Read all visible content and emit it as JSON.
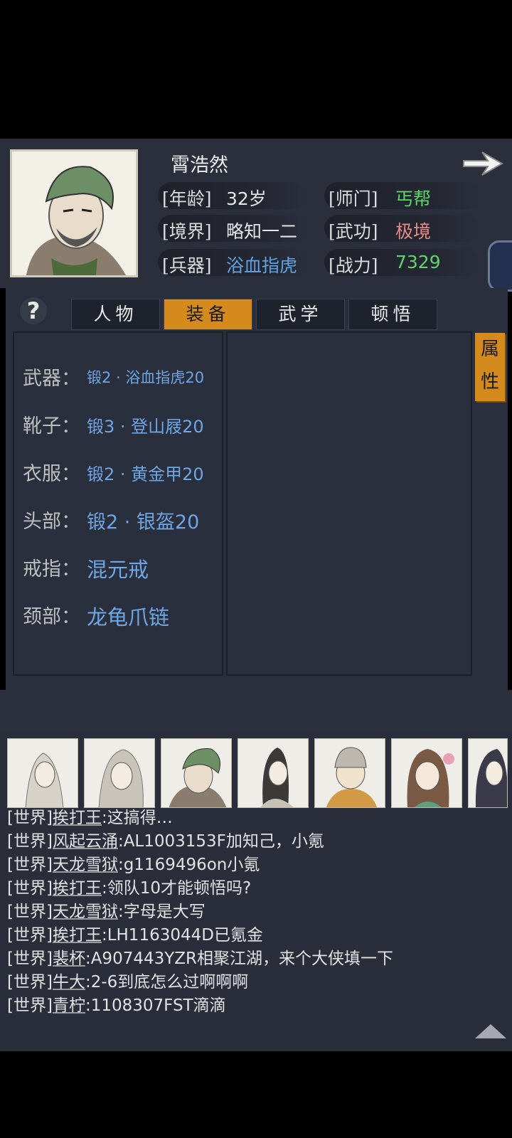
{
  "character": {
    "name": "霄浩然",
    "age_label": "[年龄]",
    "age_value": "32岁",
    "sect_label": "[师门]",
    "sect_value": "丐帮",
    "realm_label": "[境界]",
    "realm_value": "略知一二",
    "martial_label": "[武功]",
    "martial_value": "极境",
    "weapon_label": "[兵器]",
    "weapon_value": "浴血指虎",
    "power_label": "[战力]",
    "power_value": "7329"
  },
  "colors": {
    "sect": "#5fd36a",
    "martial": "#e88a86",
    "weapon": "#5fa2e6",
    "power": "#5fd36a",
    "accent_tab": "#d48a1c"
  },
  "tabs": [
    "人物",
    "装备",
    "武学",
    "顿悟"
  ],
  "active_tab": "装备",
  "side_tab": "属性",
  "equipment": [
    {
      "slot": "武器：",
      "item": "锻2 · 浴血指虎20"
    },
    {
      "slot": "靴子：",
      "item": "锻3 · 登山屐20"
    },
    {
      "slot": "衣服：",
      "item": "锻2 · 黄金甲20"
    },
    {
      "slot": "头部：",
      "item": "锻2 · 银盔20"
    },
    {
      "slot": "戒指：",
      "item": "混元戒"
    },
    {
      "slot": "颈部：",
      "item": "龙龟爪链"
    }
  ],
  "chat": [
    {
      "channel": "[世界]",
      "user": "挨打王",
      "text": ":这搞得…"
    },
    {
      "channel": "[世界]",
      "user": "风起云涌",
      "text": ":AL1003153F加知己，小氪"
    },
    {
      "channel": "[世界]",
      "user": "天龙雪狱",
      "text": ":g1169496on小氪"
    },
    {
      "channel": "[世界]",
      "user": "挨打王",
      "text": ":领队10才能顿悟吗?"
    },
    {
      "channel": "[世界]",
      "user": "天龙雪狱",
      "text": ":字母是大写"
    },
    {
      "channel": "[世界]",
      "user": "挨打王",
      "text": ":LH1163044D已氪金"
    },
    {
      "channel": "[世界]",
      "user": "裴杯",
      "text": ":A907443YZR相聚江湖，来个大侠填一下"
    },
    {
      "channel": "[世界]",
      "user": "牛大",
      "text": ":2-6到底怎么过啊啊啊"
    },
    {
      "channel": "[世界]",
      "user": "青柠",
      "text": ":1108307FST滴滴"
    }
  ]
}
